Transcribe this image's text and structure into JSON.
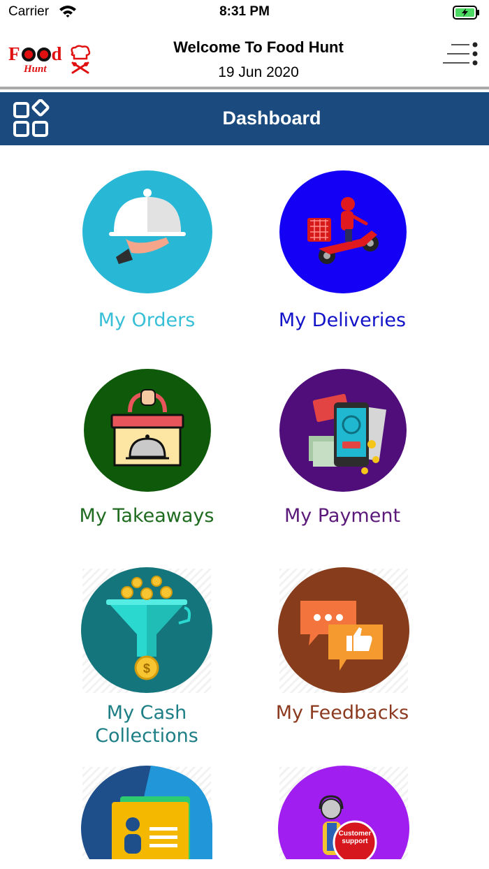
{
  "status_bar": {
    "carrier": "Carrier",
    "time": "8:31 PM",
    "battery_icon": "battery-charging-icon",
    "wifi_icon": "wifi-icon"
  },
  "header": {
    "logo_text": "Food",
    "logo_subtext": "Hunt",
    "title": "Welcome To Food Hunt",
    "date": "19 Jun 2020",
    "menu_icon": "menu-icon"
  },
  "dashboard_bar": {
    "title": "Dashboard",
    "icon": "grid-icon",
    "background": "#1b4a7e"
  },
  "tiles": [
    {
      "label": "My Orders",
      "color": "#36bfd6",
      "icon": "serving-dish-icon"
    },
    {
      "label": "My Deliveries",
      "color": "#1212c8",
      "icon": "delivery-scooter-icon"
    },
    {
      "label": "My Takeaways",
      "color": "#1f6b1f",
      "icon": "takeaway-box-icon"
    },
    {
      "label": "My Payment",
      "color": "#5b1a7a",
      "icon": "mobile-payment-icon"
    },
    {
      "label_line1": "My Cash",
      "label_line2": "Collections",
      "color": "#1d7f85",
      "icon": "cash-funnel-icon"
    },
    {
      "label": "My Feedbacks",
      "color": "#8b3a1f",
      "icon": "feedback-chat-icon"
    },
    {
      "label": "",
      "color": "#1e4f8a",
      "icon": "profile-folder-icon"
    },
    {
      "label": "",
      "color": "#a01ff0",
      "icon": "customer-support-icon",
      "badge_line1": "Customer",
      "badge_line2": "support"
    }
  ]
}
